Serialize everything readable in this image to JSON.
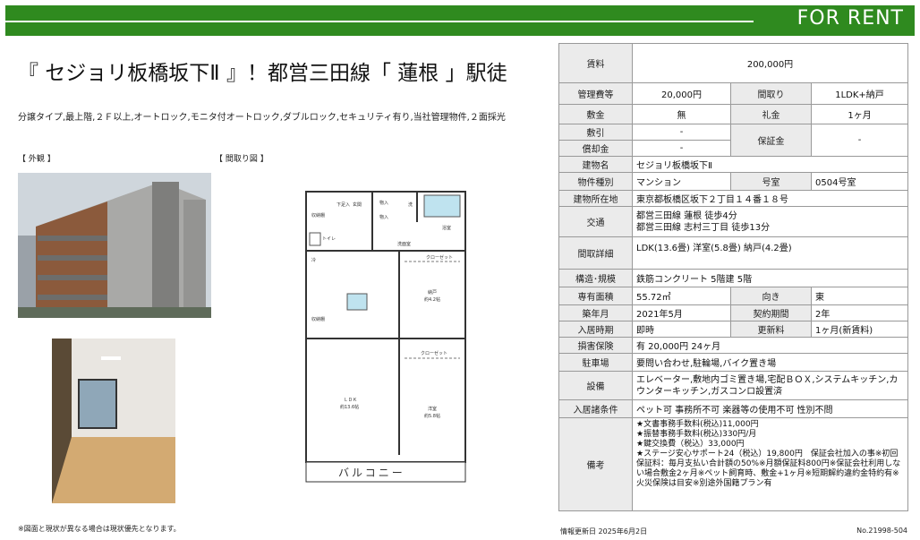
{
  "banner": {
    "label": "FOR RENT",
    "color": "#2f8a1f"
  },
  "title": "『 セジョリ板橋坂下Ⅱ 』！都営三田線「 蓮根 」駅徒",
  "subtitle": "分譲タイプ,最上階,２Ｆ以上,オートロック,モニタ付オートロック,ダブルロック,セキュリティ有り,当社管理物件,２面採光",
  "photos": {
    "exterior_label": "【 外観 】",
    "floorplan_label": "【 間取り図 】"
  },
  "floorplan": {
    "rooms": {
      "genkan": "玄関",
      "monoire1": "物入",
      "monoire2": "物入",
      "shoe": "下足入",
      "washing": "洗",
      "bath": "浴室",
      "washroom": "洗面室",
      "toilet": "トイレ",
      "fridge": "冷",
      "closet": "クローゼット",
      "storage_room": "納戸",
      "storage_size": "約4.2帖",
      "ldk": "ＬＤＫ",
      "ldk_size": "約13.6帖",
      "bedroom": "洋室",
      "bedroom_size": "約5.8帖",
      "closet2": "クローゼット",
      "shunou": "収納棚",
      "shunou2": "収納棚",
      "balcony": "バルコニー"
    }
  },
  "note": "※図面と現状が異なる場合は現状優先となります。",
  "table": {
    "rent_label": "賃料",
    "rent": "200,000円",
    "mgmt_label": "管理費等",
    "mgmt": "20,000円",
    "layout_label": "間取り",
    "layout": "1LDK+納戸",
    "deposit_label": "敷金",
    "deposit": "無",
    "keymoney_label": "礼金",
    "keymoney": "1ヶ月",
    "shikibiki_label": "敷引",
    "shikibiki": "-",
    "shokyaku_label": "償却金",
    "shokyaku": "-",
    "guarantee_label": "保証金",
    "guarantee": "-",
    "building_label": "建物名",
    "building": "セジョリ板橋坂下Ⅱ",
    "type_label": "物件種別",
    "type": "マンション",
    "room_no_label": "号室",
    "room_no": "0504号室",
    "address_label": "建物所在地",
    "address": "東京都板橋区坂下２丁目１４番１８号",
    "transport_label": "交通",
    "transport1": "都営三田線 蓮根 徒歩4分",
    "transport2": "都営三田線 志村三丁目 徒歩13分",
    "detail_label": "間取詳細",
    "detail": "LDK(13.6畳) 洋室(5.8畳) 納戸(4.2畳)",
    "structure_label": "構造･規模",
    "structure": "鉄筋コンクリート 5階建 5階",
    "area_label": "専有面積",
    "area": "55.72㎡",
    "direction_label": "向き",
    "direction": "東",
    "built_label": "築年月",
    "built": "2021年5月",
    "term_label": "契約期間",
    "term": "2年",
    "movein_label": "入居時期",
    "movein": "即時",
    "renewal_label": "更新料",
    "renewal": "1ヶ月(新賃料)",
    "insurance_label": "損害保険",
    "insurance": "有 20,000円 24ヶ月",
    "parking_label": "駐車場",
    "parking": "要問い合わせ,駐輪場,バイク置き場",
    "facility_label": "設備",
    "facility": "エレベーター,敷地内ゴミ置き場,宅配ＢＯＸ,システムキッチン,カウンターキッチン,ガスコンロ設置済",
    "conditions_label": "入居諸条件",
    "conditions": "ペット可 事務所不可 楽器等の使用不可 性別不問",
    "remarks_label": "備考",
    "remarks": [
      "★文書事務手数料(税込)11,000円",
      "★振替事務手数料(税込)330円/月",
      "★鍵交換費（税込）33,000円",
      "★ステージ安心サポート24（税込）19,800円　保証会社加入の事※初回保証料：毎月支払い合計額の50%※月額保証料800円※保証会社利用しない場合敷金2ヶ月※ペット飼育時、敷金+1ヶ月※短期解約違約金特約有※火災保険は目安※別途外国籍プラン有"
    ]
  },
  "footer": {
    "updated": "情報更新日 2025年6月2日",
    "number": "No.21998-504"
  }
}
